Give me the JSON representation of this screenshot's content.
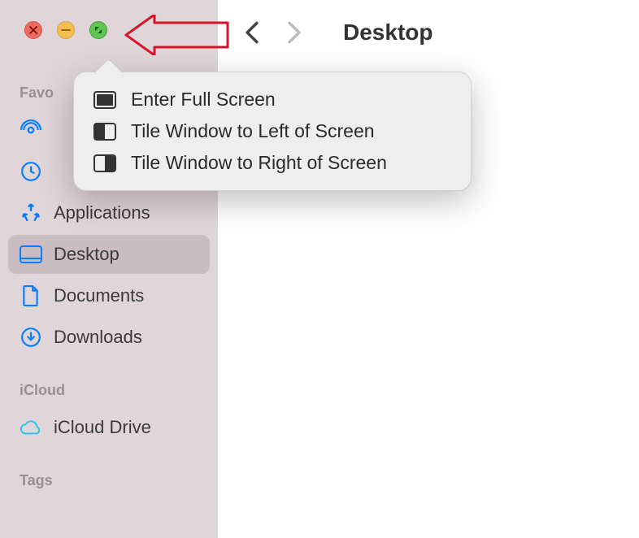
{
  "sidebar": {
    "sections": [
      {
        "header": "Favo",
        "items": [
          {
            "label": "",
            "icon": "airdrop"
          },
          {
            "label": "",
            "icon": "recents"
          },
          {
            "label": "Applications",
            "icon": "applications"
          },
          {
            "label": "Desktop",
            "icon": "desktop",
            "selected": true
          },
          {
            "label": "Documents",
            "icon": "documents"
          },
          {
            "label": "Downloads",
            "icon": "downloads"
          }
        ]
      },
      {
        "header": "iCloud",
        "items": [
          {
            "label": "iCloud Drive",
            "icon": "icloud"
          }
        ]
      },
      {
        "header": "Tags",
        "items": []
      }
    ]
  },
  "toolbar": {
    "title": "Desktop"
  },
  "popover": {
    "items": [
      {
        "label": "Enter Full Screen",
        "icon": "full"
      },
      {
        "label": "Tile Window to Left of Screen",
        "icon": "left"
      },
      {
        "label": "Tile Window to Right of Screen",
        "icon": "right"
      }
    ]
  },
  "annotation": {
    "color": "#d4152a"
  }
}
